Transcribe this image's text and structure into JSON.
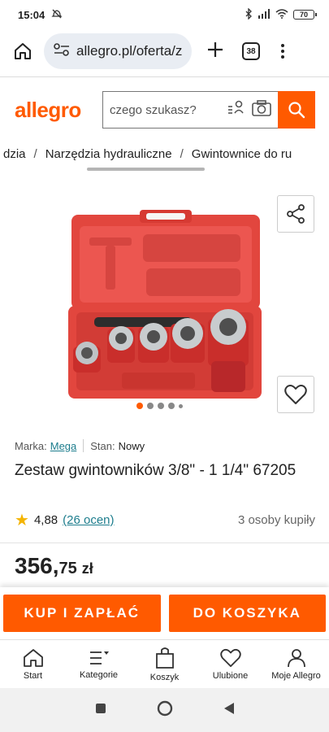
{
  "status_bar": {
    "time": "15:04",
    "battery": "70"
  },
  "browser": {
    "url": "allegro.pl/oferta/z",
    "tab_count": "38"
  },
  "header": {
    "logo": "allegro",
    "search_placeholder": "czego szukasz?"
  },
  "breadcrumb": [
    "dzia",
    "Narzędzia hydrauliczne",
    "Gwintownice do ru"
  ],
  "product": {
    "brand_label": "Marka:",
    "brand": "Mega",
    "condition_label": "Stan:",
    "condition": "Nowy",
    "title": "Zestaw gwintowników 3/8\" - 1 1/4\" 67205",
    "rating": "4,88",
    "rating_count": "(26 ocen)",
    "buyers": "3 osoby kupiły",
    "price_int": "356,",
    "price_frac": "75",
    "currency": "zł",
    "gallery_dots": 5,
    "gallery_active": 1
  },
  "cta": {
    "buy": "KUP I ZAPŁAĆ",
    "cart": "DO KOSZYKA"
  },
  "nav": [
    {
      "label": "Start",
      "icon": "home-icon"
    },
    {
      "label": "Kategorie",
      "icon": "categories-icon"
    },
    {
      "label": "Koszyk",
      "icon": "cart-icon"
    },
    {
      "label": "Ulubione",
      "icon": "heart-icon"
    },
    {
      "label": "Moje Allegro",
      "icon": "user-icon"
    }
  ],
  "colors": {
    "accent": "#ff5a00",
    "link": "#1d7d8d"
  }
}
